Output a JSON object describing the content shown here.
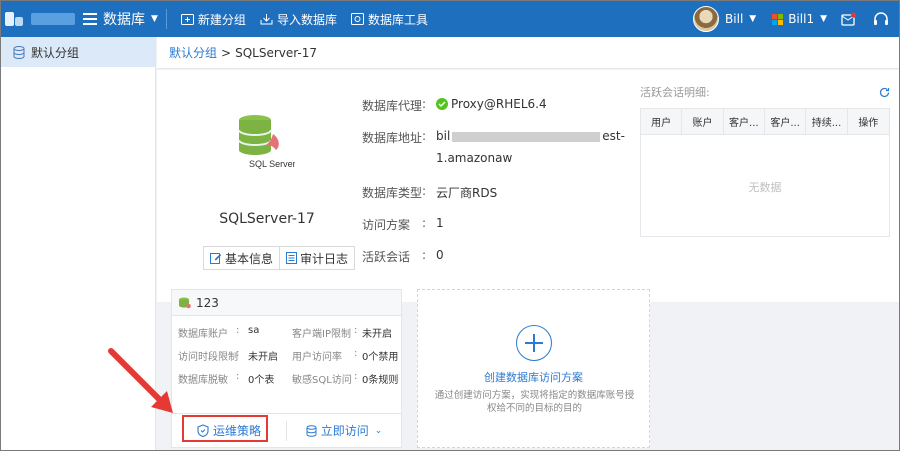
{
  "topbar": {
    "module": "数据库",
    "buttons": [
      "新建分组",
      "导入数据库",
      "数据库工具"
    ],
    "user": "Bill",
    "tenant": "Bill1",
    "win_colors": [
      "#f25022",
      "#7fba00",
      "#00a4ef",
      "#ffb900"
    ]
  },
  "sidebar": {
    "items": [
      {
        "label": "默认分组",
        "icon": "database-icon"
      }
    ]
  },
  "breadcrumb": {
    "parent": "默认分组",
    "separator": ">",
    "current": "SQLServer-17"
  },
  "info": {
    "db_name": "SQLServer-17",
    "logo_text": "SQL Server",
    "btn_basic": "基本信息",
    "btn_audit": "审计日志",
    "proxy_label": "数据库代理",
    "proxy_value": "Proxy@RHEL6.4",
    "addr_label": "数据库地址",
    "addr_prefix": "bil",
    "addr_suffix": "est-",
    "addr_line2": "1.amazonaw",
    "type_label": "数据库类型",
    "type_value": "云厂商RDS",
    "scheme_label": "访问方案",
    "scheme_value": "1",
    "session_label": "活跃会话",
    "session_value": "0",
    "colon": ":"
  },
  "sessions": {
    "title": "活跃会话明细:",
    "columns": [
      "用户",
      "账户",
      "客户...",
      "客户...",
      "持续...",
      "操作"
    ],
    "empty": "无数据"
  },
  "plan": {
    "name": "123",
    "rows": [
      {
        "k1": "数据库账户",
        "v1": "sa",
        "k2": "客户端IP限制",
        "v2": "未开启"
      },
      {
        "k1": "访问时段限制",
        "v1": "未开启",
        "k2": "用户访问率",
        "v2": "0个禁用"
      },
      {
        "k1": "数据库脱敏",
        "v1": "0个表",
        "k2": "敏感SQL访问",
        "v2": "0条规则"
      }
    ],
    "colon": ":",
    "ops_label": "运维策略",
    "access_label": "立即访问"
  },
  "create": {
    "title": "创建数据库访问方案",
    "desc": "通过创建访问方案，实现将指定的数据库账号授权给不同的目标的目的"
  },
  "colors": {
    "primary": "#1f6fbf",
    "link": "#2b7bd2",
    "annotation": "#e53935"
  }
}
